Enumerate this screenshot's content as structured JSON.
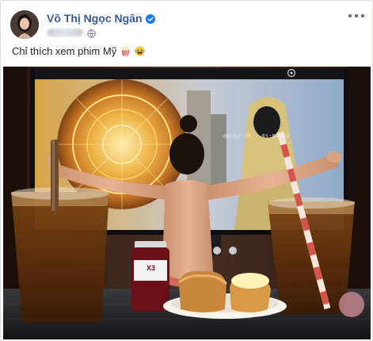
{
  "post": {
    "author": "Võ Thị Ngọc Ngân",
    "caption": "Chỉ thích xem phim Mỹ",
    "verified": true,
    "audience_icon": "globe-icon",
    "caption_emojis": [
      "popcorn-icon",
      "laughing-face-icon"
    ]
  },
  "photo": {
    "player_time": "00:02:36 - 01:54:58",
    "cup_label": "X3"
  },
  "colors": {
    "author_link": "#385898",
    "verified_badge": "#1877f2"
  }
}
